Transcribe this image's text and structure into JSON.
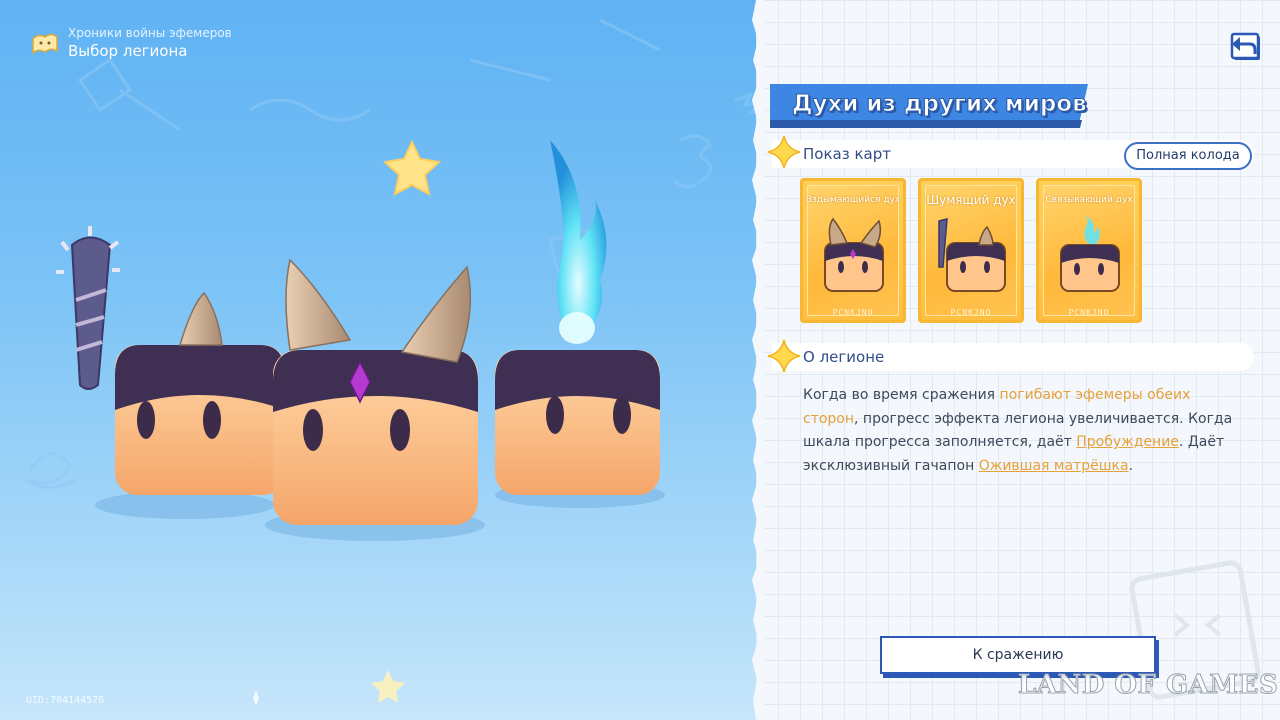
{
  "header": {
    "subtitle": "Хроники войны эфемеров",
    "title": "Выбор легиона"
  },
  "uid": "UID:704144576",
  "panel": {
    "title": "Духи из других миров",
    "cards_section": {
      "label": "Показ карт",
      "full_deck_button": "Полная колода",
      "cards": [
        {
          "name": "Вздымающийся дух",
          "footer": "PCNKJNO"
        },
        {
          "name": "Шумящий дух",
          "footer": "PCNKJNO"
        },
        {
          "name": "Связывающий дух",
          "footer": "PCNKJNO"
        }
      ]
    },
    "legion_section": {
      "label": "О легионе",
      "desc_1": "Когда во время сражения ",
      "desc_hl_1": "погибают эфемеры обеих сторон",
      "desc_2": ", прогресс эффекта легиона увеличивается. Когда шкала прогресса заполняется, даёт ",
      "desc_link_1": "Пробуждение",
      "desc_3": ". Даёт эксклюзивный гачапон ",
      "desc_link_2": "Ожившая матрёшка",
      "desc_4": "."
    },
    "battle_button": "К сражению"
  },
  "watermark": "LAND OF GAMES",
  "colors": {
    "accent_blue": "#2b59b5",
    "highlight_orange": "#e6a13a",
    "card_gold": "#f7b733",
    "sky_blue": "#6fb8f0"
  },
  "icons": [
    "scroll-icon",
    "back-arrow-icon",
    "star-icon"
  ]
}
